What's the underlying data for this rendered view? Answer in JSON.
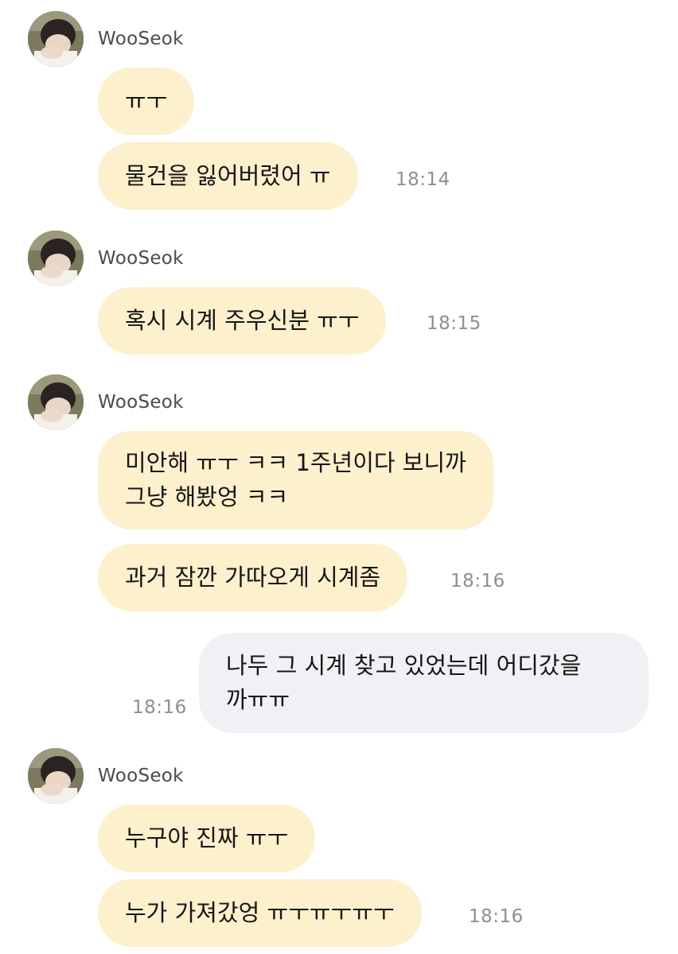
{
  "chat": {
    "messages": [
      {
        "sender": "WooSeok",
        "bubbles": [
          "ㅠㅜ",
          "물건을 잃어버렸어 ㅠ"
        ],
        "time": "18:14"
      },
      {
        "sender": "WooSeok",
        "bubbles": [
          "혹시 시계 주우신분 ㅠㅜ"
        ],
        "time": "18:15"
      },
      {
        "sender": "WooSeok",
        "bubbles": [
          "미안해 ㅠㅜ ㅋㅋ 1주년이다 보니까",
          "그냥 해봤엉 ㅋㅋ",
          "과거 잠깐 가따오게 시계좀"
        ],
        "time": "18:16"
      },
      {
        "sender": "me",
        "bubbles": [
          "나두 그 시계 찾고 있었는데 어디갔을",
          "까ㅠㅠ"
        ],
        "time": "18:16"
      },
      {
        "sender": "WooSeok",
        "bubbles": [
          "누구야 진짜 ㅠㅜ",
          "누가 가져갔엉 ㅠㅜㅠㅜㅠㅜ"
        ],
        "time": "18:16"
      }
    ]
  },
  "colors": {
    "incoming_bubble": "#fdf0cd",
    "outgoing_bubble": "#f0f1f4",
    "time_text": "#8e8e93"
  },
  "icons": {
    "avatar": "profile-photo"
  }
}
